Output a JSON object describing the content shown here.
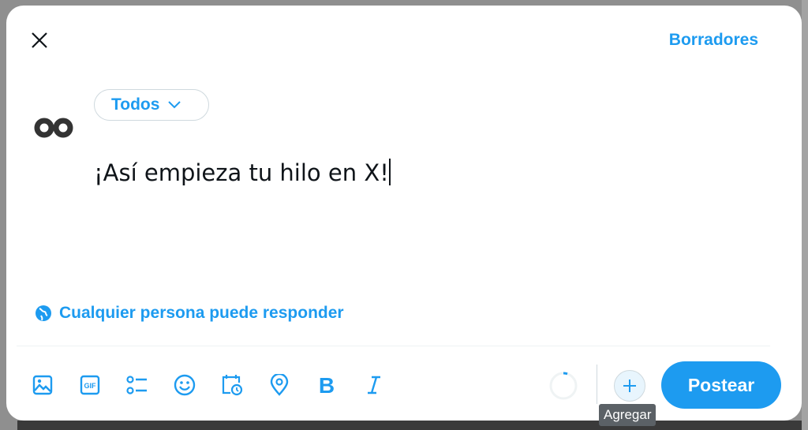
{
  "header": {
    "drafts_label": "Borradores"
  },
  "composer": {
    "audience": "Todos",
    "text": "¡Así empieza tu hilo en X!",
    "reply_setting": "Cualquier persona puede responder"
  },
  "toolbar": {
    "icons": [
      "image-icon",
      "gif-icon",
      "poll-icon",
      "emoji-icon",
      "schedule-icon",
      "location-icon",
      "bold-icon",
      "italic-icon"
    ],
    "add_tooltip": "Agregar",
    "post_label": "Postear"
  },
  "colors": {
    "accent": "#1d9bf0",
    "text": "#0f1419"
  }
}
